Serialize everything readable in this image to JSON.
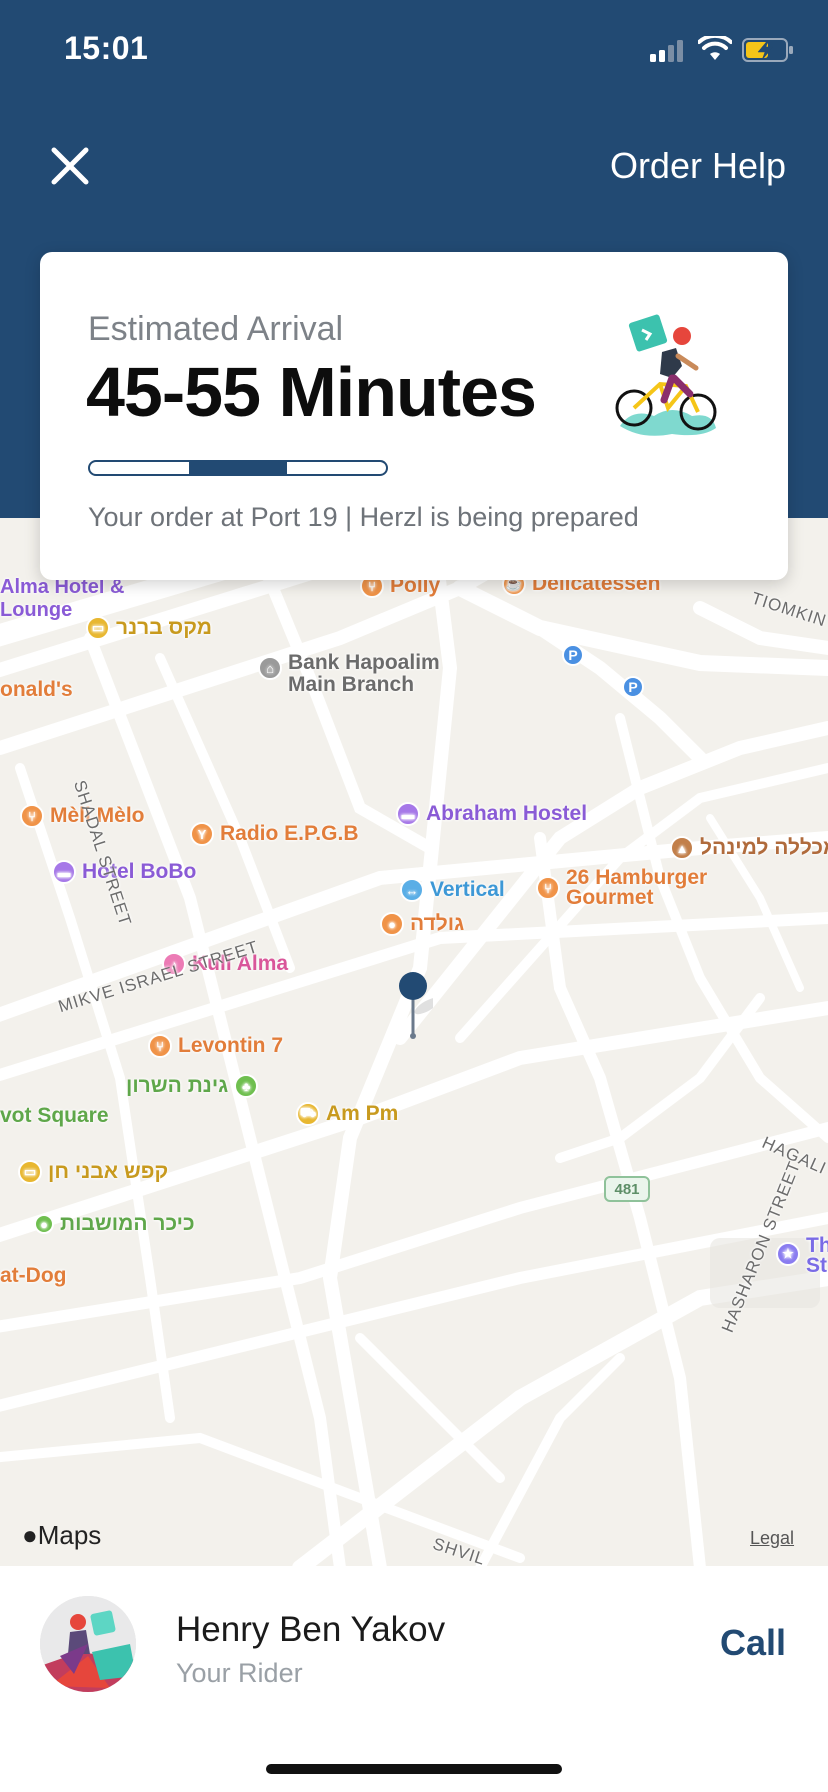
{
  "status_bar": {
    "time": "15:01",
    "icons": [
      "signal-icon",
      "wifi-icon",
      "battery-charging-icon"
    ]
  },
  "header": {
    "close_icon": "close-icon",
    "order_help_label": "Order Help",
    "background_color": "#224a73"
  },
  "eta_card": {
    "label": "Estimated Arrival",
    "value": "45-55 Minutes",
    "progress_segments": 3,
    "active_segment": 2,
    "status_text": "Your order at Port 19 | Herzl is being prepared"
  },
  "map": {
    "pois": [
      {
        "name": "Alma Hotel &",
        "name2": "Lounge",
        "type": "hotel"
      },
      {
        "name": "Polly",
        "type": "restaurant"
      },
      {
        "name": "Delicatessen",
        "type": "cafe"
      },
      {
        "name": "מקס ברנר",
        "type": "shop"
      },
      {
        "name": "Bank Hapoalim",
        "name2": "Main Branch",
        "type": "bank"
      },
      {
        "name": "onald's",
        "type": "restaurant"
      },
      {
        "name": "Mèli Mèlo",
        "type": "restaurant"
      },
      {
        "name": "Radio E.P.G.B",
        "type": "bar"
      },
      {
        "name": "Abraham Hostel",
        "type": "hotel"
      },
      {
        "name": "Hotel BoBo",
        "type": "hotel"
      },
      {
        "name": "מכללה למינהל",
        "type": "school"
      },
      {
        "name": "Vertical",
        "type": "gym"
      },
      {
        "name": "26 Hamburger",
        "name2": "Gourmet",
        "type": "restaurant"
      },
      {
        "name": "גולדה",
        "type": "icecream"
      },
      {
        "name": "Kuli Alma",
        "type": "music"
      },
      {
        "name": "Levontin 7",
        "type": "restaurant"
      },
      {
        "name": "גינת השרון",
        "type": "park"
      },
      {
        "name": "vot Square",
        "type": "park"
      },
      {
        "name": "Am Pm",
        "type": "grocery"
      },
      {
        "name": "קפש אבני חן",
        "type": "shop"
      },
      {
        "name": "כיכר המושבות",
        "type": "park"
      },
      {
        "name": "at-Dog",
        "type": "restaurant"
      },
      {
        "name": "Th",
        "name2": "St",
        "type": "landmark"
      }
    ],
    "streets": [
      "TIOMKIN",
      "SHADAL STREET",
      "MIKVE ISRAEL STREET",
      "HASHARON STREET",
      "HAGALI",
      "SHVIL"
    ],
    "route_shield": "481",
    "parking_label": "P",
    "brand": "Maps",
    "legal_label": "Legal"
  },
  "rider": {
    "name": "Henry Ben Yakov",
    "role": "Your Rider",
    "call_label": "Call"
  }
}
